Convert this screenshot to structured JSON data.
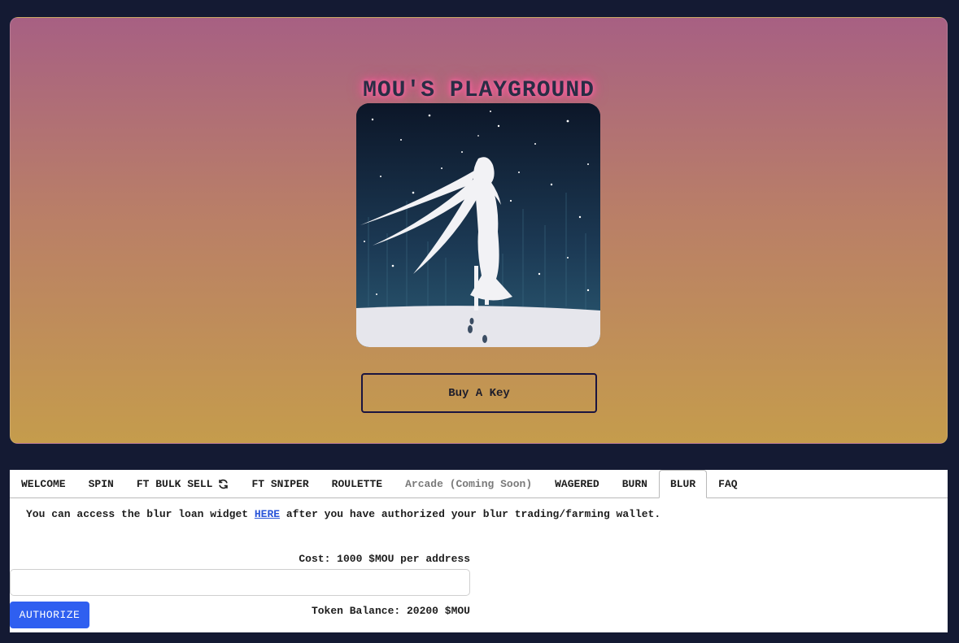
{
  "hero": {
    "title": "MOU'S PLAYGROUND",
    "image_alt": "anime-girl-in-snow-artwork",
    "buy_button_label": "Buy A Key"
  },
  "tabs": [
    {
      "label": "WELCOME",
      "active": false,
      "disabled": false
    },
    {
      "label": "SPIN",
      "active": false,
      "disabled": false
    },
    {
      "label": "FT BULK SELL",
      "active": false,
      "disabled": false,
      "icon": "refresh-icon"
    },
    {
      "label": "FT SNIPER",
      "active": false,
      "disabled": false
    },
    {
      "label": "ROULETTE",
      "active": false,
      "disabled": false
    },
    {
      "label": "Arcade (Coming Soon)",
      "active": false,
      "disabled": true
    },
    {
      "label": "WAGERED",
      "active": false,
      "disabled": false
    },
    {
      "label": "BURN",
      "active": false,
      "disabled": false
    },
    {
      "label": "BLUR",
      "active": true,
      "disabled": false
    },
    {
      "label": "FAQ",
      "active": false,
      "disabled": false
    }
  ],
  "blur": {
    "info_prefix": "You can access the blur loan widget ",
    "info_link": "HERE",
    "info_suffix": " after you have authorized your blur trading/farming wallet.",
    "cost_label": "Cost: 1000 $MOU per address",
    "address_value": "",
    "address_placeholder": "",
    "authorize_label": "AUTHORIZE",
    "balance_label": "Token Balance: 20200 $MOU"
  },
  "colors": {
    "page_background": "#141a33",
    "hero_gradient_top": "#a76083",
    "hero_gradient_bottom": "#c59c4c",
    "title_glow": "#ff4f98",
    "authorize_button": "#2f5ff0",
    "link": "#2a55d9"
  }
}
